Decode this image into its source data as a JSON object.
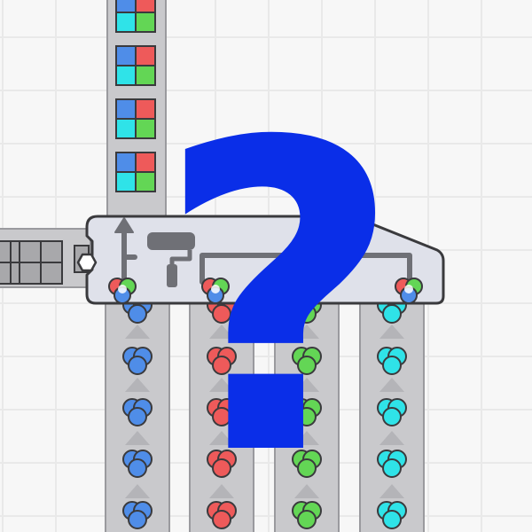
{
  "overlay": {
    "symbol": "?",
    "color": "#0a2ee8"
  },
  "palette": {
    "background": "#f7f7f7",
    "grid_line": "#e9e9e9",
    "belt_fill": "#c9c9cc",
    "belt_edge": "#9a9a9e",
    "machine_fill": "#dfe1ea",
    "machine_edge": "#3a3a3d",
    "blue": "#4f8de8",
    "red": "#ee5a5a",
    "green": "#63d655",
    "cyan": "#2fe3e8"
  },
  "input_belt": {
    "item": "quad-shape",
    "quadrants": [
      "#ee5a5a",
      "#63d655",
      "#4f8de8",
      "#2fe3e8"
    ]
  },
  "side_belt": {
    "item": "gray-quad-shape"
  },
  "machine": {
    "name": "color-splitter",
    "indicators": [
      "rgb-indicator",
      "rgb-indicator",
      "rgb-indicator",
      "rgb-indicator"
    ]
  },
  "output_belts": [
    {
      "name": "blue",
      "color": "#4f8de8"
    },
    {
      "name": "red",
      "color": "#ee5a5a"
    },
    {
      "name": "green",
      "color": "#63d655"
    },
    {
      "name": "cyan",
      "color": "#2fe3e8"
    }
  ]
}
